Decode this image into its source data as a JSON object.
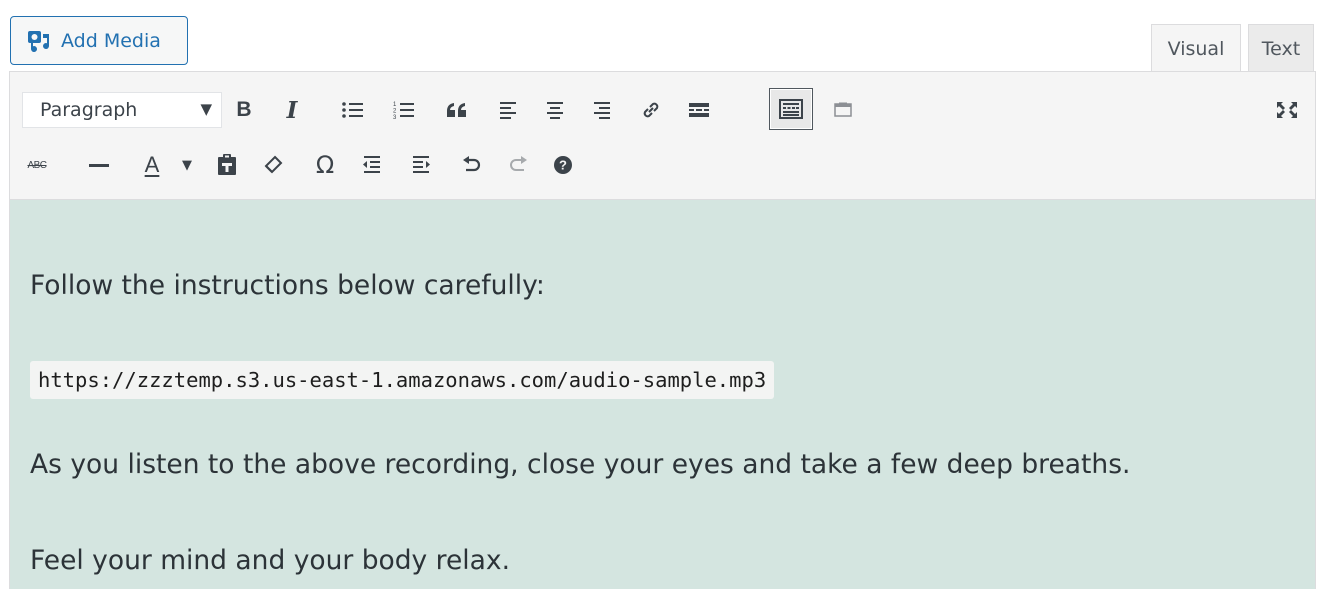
{
  "top": {
    "add_media_label": "Add Media",
    "tabs": [
      {
        "label": "Visual",
        "active": true
      },
      {
        "label": "Text",
        "active": false
      }
    ]
  },
  "toolbar": {
    "format_select": {
      "value": "Paragraph"
    },
    "row1": [
      "bold-icon",
      "italic-icon",
      "bullet-list-icon",
      "numbered-list-icon",
      "blockquote-icon",
      "align-left-icon",
      "align-center-icon",
      "align-right-icon",
      "link-icon",
      "read-more-icon",
      "toolbar-toggle-icon",
      "insert-placeholder-icon",
      "fullscreen-icon"
    ],
    "row2": [
      "strikethrough-icon",
      "horizontal-line-icon",
      "text-color-icon",
      "text-color-dropdown-icon",
      "paste-as-text-icon",
      "clear-formatting-icon",
      "special-character-icon",
      "outdent-icon",
      "indent-icon",
      "undo-icon",
      "redo-icon",
      "help-icon"
    ],
    "strikethrough_label": "ABC",
    "text_color_label": "A",
    "italic_label": "I",
    "bold_label": "B",
    "omega_label": "Ω",
    "accent_color": "#2271b1"
  },
  "content": {
    "paragraph_1": "Follow the instructions below carefully:",
    "code_url": "https://zzztemp.s3.us-east-1.amazonaws.com/audio-sample.mp3",
    "paragraph_3": "As you listen to the above recording, close your eyes and take a few deep breaths.",
    "paragraph_4": "Feel your mind and your body relax.",
    "background_color": "#d4e5e0"
  }
}
